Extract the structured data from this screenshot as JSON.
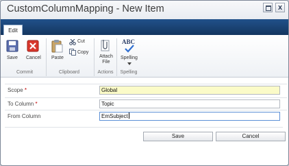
{
  "window": {
    "title": "CustomColumnMapping - New Item",
    "close_glyph": "x"
  },
  "ribbon": {
    "tab": "Edit",
    "groups": {
      "commit": {
        "label": "Commit",
        "save": "Save",
        "cancel": "Cancel"
      },
      "clipboard": {
        "label": "Clipboard",
        "paste": "Paste",
        "cut": "Cut",
        "copy": "Copy"
      },
      "actions": {
        "label": "Actions",
        "attach_line1": "Attach",
        "attach_line2": "File"
      },
      "spelling": {
        "label": "Spelling",
        "spelling": "Spelling",
        "abc": "ABC"
      }
    }
  },
  "form": {
    "fields": [
      {
        "label": "Scope",
        "required": "*",
        "value": "Global"
      },
      {
        "label": "To Column",
        "required": "*",
        "value": "Topic"
      },
      {
        "label": "From Column",
        "required": "",
        "value": "EmSubject"
      }
    ],
    "save_label": "Save",
    "cancel_label": "Cancel"
  },
  "colors": {
    "title_bar": "#e9ecf1",
    "ribbon_band": "#1d4a7e",
    "highlight_field": "#fbfbc8",
    "required": "#c00000"
  }
}
